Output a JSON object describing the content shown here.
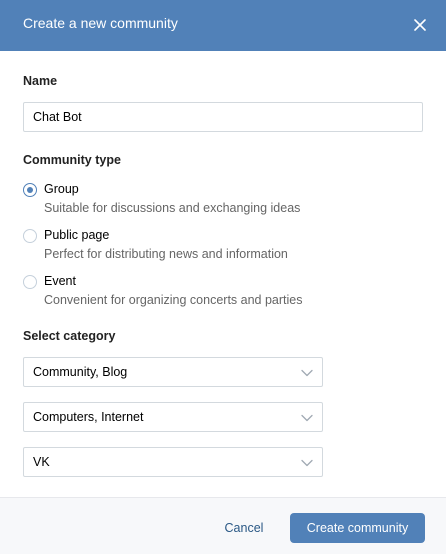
{
  "header": {
    "title": "Create a new community",
    "close_icon": "close-icon",
    "background_color": "#5181b8"
  },
  "name_section": {
    "label": "Name",
    "input_value": "Chat Bot"
  },
  "community_type": {
    "label": "Community type",
    "selected": "group",
    "options": [
      {
        "id": "group",
        "title": "Group",
        "description": "Suitable for discussions and exchanging ideas",
        "checked": true
      },
      {
        "id": "public_page",
        "title": "Public page",
        "description": "Perfect for distributing news and information",
        "checked": false
      },
      {
        "id": "event",
        "title": "Event",
        "description": "Convenient for organizing concerts and parties",
        "checked": false
      }
    ]
  },
  "category": {
    "label": "Select category",
    "selects": [
      {
        "value": "Community, Blog"
      },
      {
        "value": "Computers, Internet"
      },
      {
        "value": "VK"
      }
    ],
    "chevron_icon": "chevron-down-icon"
  },
  "footer": {
    "cancel_label": "Cancel",
    "create_label": "Create community",
    "accent_color": "#5181b8",
    "link_color": "#2a5885"
  }
}
